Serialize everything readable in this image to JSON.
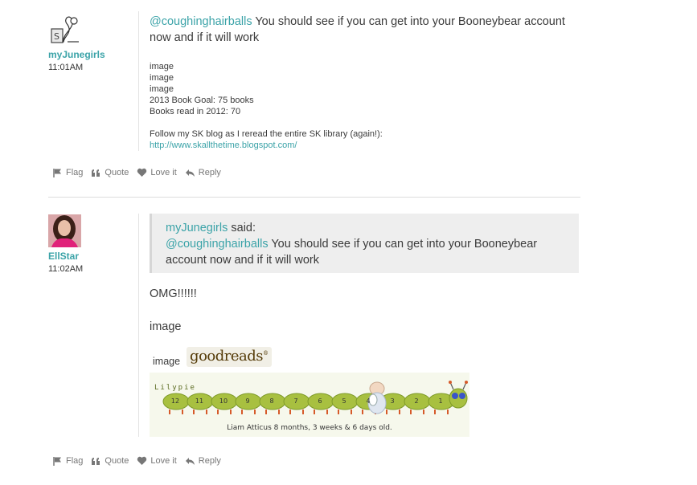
{
  "post1": {
    "username": "myJunegirls",
    "time": "11:01AM",
    "mention": "@coughinghairballs",
    "message": " You should see if you can get into your Booneybear account now and if it will work",
    "sig_lines": [
      "image",
      "image",
      "image",
      "2013 Book Goal: 75 books",
      "Books read in 2012: 70"
    ],
    "blog_text": "Follow my SK blog as I reread the entire SK library (again!):",
    "blog_url": "http://www.skallthetime.blogspot.com/"
  },
  "post2": {
    "username": "EllStar",
    "time": "11:02AM",
    "quote_author": "myJunegirls",
    "quote_said": " said:",
    "quote_mention": "@coughinghairballs",
    "quote_text": " You should see if you can get into your Booneybear account now and if it will work",
    "message": "OMG!!!!!!",
    "image1": "image",
    "image2": "image",
    "goodreads_logo": "goodreads",
    "lilypie_brand": "Lilypie",
    "ticker_numbers": [
      "12",
      "11",
      "10",
      "9",
      "8",
      "7",
      "6",
      "5",
      "4",
      "3",
      "2",
      "1"
    ],
    "ticker_caption": "Liam Atticus 8 months, 3 weeks & 6 days old."
  },
  "actions": {
    "flag": "Flag",
    "quote": "Quote",
    "love": "Love it",
    "reply": "Reply"
  },
  "colors": {
    "accent": "#3ba3a8",
    "text": "#3a3a3a",
    "muted": "#777777"
  }
}
